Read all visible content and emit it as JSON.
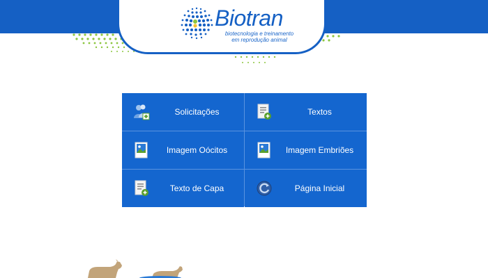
{
  "brand": {
    "name": "Biotran",
    "tagline_line1": "biotecnologia e treinamento",
    "tagline_line2": "em reprodução animal",
    "primary_color": "#1560c4",
    "accent_green": "#8cc63f"
  },
  "menu": {
    "items": [
      {
        "label": "Solicitações",
        "icon": "users-add-icon"
      },
      {
        "label": "Textos",
        "icon": "document-add-icon"
      },
      {
        "label": "Imagem Oócitos",
        "icon": "image-icon"
      },
      {
        "label": "Imagem Embriões",
        "icon": "image-icon"
      },
      {
        "label": "Texto de Capa",
        "icon": "document-add-icon"
      },
      {
        "label": "Página Inicial",
        "icon": "refresh-icon"
      }
    ]
  }
}
